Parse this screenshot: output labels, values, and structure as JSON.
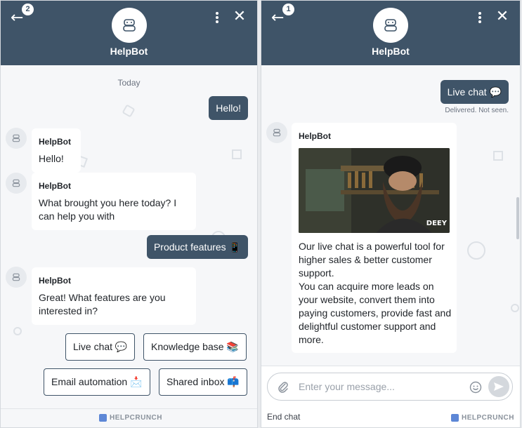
{
  "left": {
    "header": {
      "badge": "2",
      "title": "HelpBot"
    },
    "day_label": "Today",
    "messages": {
      "out1": "Hello!",
      "in1_sender": "HelpBot",
      "in1_text": "Hello!",
      "in2_sender": "HelpBot",
      "in2_text": "What brought you here today? I can help you with",
      "out2": "Product features 📱",
      "in3_sender": "HelpBot",
      "in3_text": "Great! What features are you interested in?"
    },
    "quick_replies": [
      "Live chat 💬",
      "Knowledge base 📚",
      "Email automation 📩",
      "Shared inbox 📫"
    ],
    "brand": "HELPCRUNCH"
  },
  "right": {
    "header": {
      "badge": "1",
      "title": "HelpBot"
    },
    "messages": {
      "out1": "Live chat 💬",
      "status": "Delivered. Not seen.",
      "in_sender": "HelpBot",
      "gif_label": "DEEY",
      "in_text_1": "Our live chat is a powerful tool for higher sales & better customer support.",
      "in_text_2": "You can acquire more leads on your website, convert them into paying customers, provide fast and delightful customer support and more."
    },
    "composer": {
      "placeholder": "Enter your message..."
    },
    "end_chat": "End chat",
    "brand": "HELPCRUNCH"
  },
  "colors": {
    "header": "#3f5468",
    "background": "#f6f7f9",
    "accent": "#5d87d6"
  },
  "icons": [
    "back-arrow-icon",
    "bot-icon",
    "more-vertical-icon",
    "close-icon",
    "paperclip-icon",
    "emoji-icon",
    "send-icon"
  ]
}
